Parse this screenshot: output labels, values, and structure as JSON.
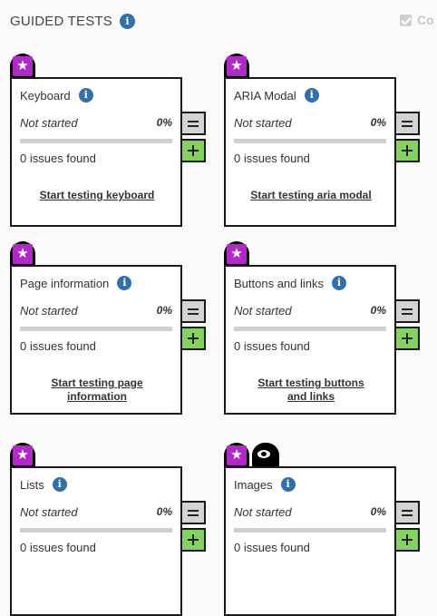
{
  "header": {
    "title": "GUIDED TESTS",
    "info_icon": "info-icon",
    "completed_toggle": {
      "label": "Co",
      "checked": true
    }
  },
  "colors": {
    "star_badge": "#b229c9",
    "info_icon": "#3470a8",
    "add_button": "#86d162",
    "collapse_button": "#d3d3d3",
    "progress_track": "#cfcfcf"
  },
  "cards": [
    {
      "title": "Keyboard",
      "status": "Not started",
      "percent": "0%",
      "progress": 0,
      "issues": "0 issues found",
      "link": "Start testing keyboard",
      "icons": [
        "star-icon"
      ]
    },
    {
      "title": "ARIA Modal",
      "status": "Not started",
      "percent": "0%",
      "progress": 0,
      "issues": "0 issues found",
      "link": "Start testing aria modal",
      "icons": [
        "star-icon"
      ]
    },
    {
      "title": "Page information",
      "status": "Not started",
      "percent": "0%",
      "progress": 0,
      "issues": "0 issues found",
      "link": "Start testing page information",
      "icons": [
        "star-icon"
      ]
    },
    {
      "title": "Buttons and links",
      "status": "Not started",
      "percent": "0%",
      "progress": 0,
      "issues": "0 issues found",
      "link": "Start testing buttons and links",
      "icons": [
        "star-icon"
      ]
    },
    {
      "title": "Lists",
      "status": "Not started",
      "percent": "0%",
      "progress": 0,
      "issues": "0 issues found",
      "link": "",
      "icons": [
        "star-icon"
      ]
    },
    {
      "title": "Images",
      "status": "Not started",
      "percent": "0%",
      "progress": 0,
      "issues": "0 issues found",
      "link": "",
      "icons": [
        "star-icon",
        "eye-icon"
      ]
    }
  ]
}
